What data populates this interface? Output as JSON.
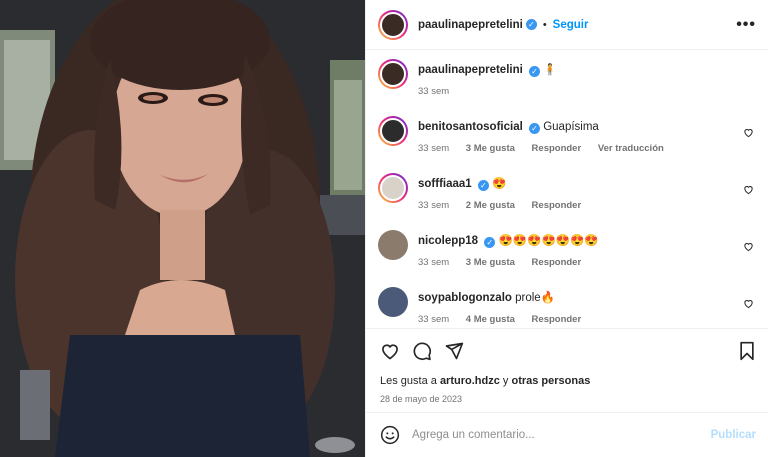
{
  "post": {
    "author": "paaulinapepretelini",
    "follow_label": "Seguir",
    "more_label": "•••",
    "dot": "•"
  },
  "caption": {
    "username": "paaulinapepretelini",
    "text": "🧍",
    "time": "33 sem"
  },
  "comments": [
    {
      "username": "benitosantosoficial",
      "verified": true,
      "text": "Guapísima",
      "time": "33 sem",
      "likes": "3 Me gusta",
      "reply": "Responder",
      "translate": "Ver traducción",
      "avatar_color": "#2c2c2c"
    },
    {
      "username": "sofffiaaa1",
      "verified": true,
      "text": "😍",
      "time": "33 sem",
      "likes": "2 Me gusta",
      "reply": "Responder",
      "translate": "",
      "avatar_color": "#d8d2c8"
    },
    {
      "username": "nicolepp18",
      "verified": true,
      "text": "😍😍😍😍😍😍😍",
      "time": "33 sem",
      "likes": "3 Me gusta",
      "reply": "Responder",
      "translate": "",
      "avatar_color": "#8a7b6c"
    },
    {
      "username": "soypablogonzalo",
      "verified": false,
      "text": "prole🔥",
      "time": "33 sem",
      "likes": "4 Me gusta",
      "reply": "Responder",
      "translate": "",
      "avatar_color": "#4a5a78"
    }
  ],
  "likes": {
    "prefix": "Les gusta a",
    "user": "arturo.hdzc",
    "joiner": "y",
    "others": "otras personas"
  },
  "date": "28 de mayo de 2023",
  "add_comment": {
    "placeholder": "Agrega un comentario...",
    "publish_label": "Publicar"
  },
  "verified_glyph": "✓",
  "colors": {
    "accent": "#0095f6",
    "publish_disabled": "#b2dffc",
    "muted": "#737373"
  }
}
